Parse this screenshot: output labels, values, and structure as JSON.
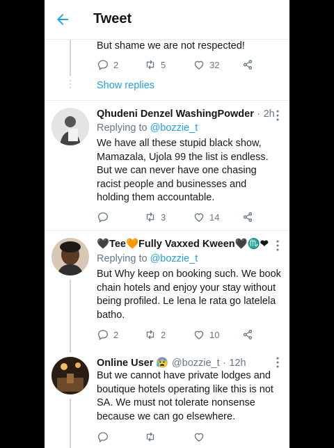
{
  "header": {
    "title": "Tweet"
  },
  "top_tweet": {
    "text": "But shame we are not respected!",
    "replies": "2",
    "retweets": "5",
    "likes": "32",
    "show_replies": "Show replies"
  },
  "tweets": [
    {
      "name": "Qhudeni Denzel WashingPowder",
      "sep": "·",
      "time": "2h",
      "replying_prefix": "Replying to ",
      "replying_to": "@bozzie_t",
      "text": "We have all these stupid black show, Mamazala, Ujola 99 the list is endless. But we can never have one chasing racist people and businesses and holding them accountable.",
      "replies": "",
      "retweets": "3",
      "likes": "14"
    },
    {
      "name": "🖤Tee🧡Fully Vaxxed Kween🖤♏❤",
      "replying_prefix": "Replying to ",
      "replying_to": "@bozzie_t",
      "text": "But Why keep on booking such. We book chain hotels and enjoy your stay without being profiled. Le lena le rata go latelela batho.",
      "replies": "2",
      "retweets": "2",
      "likes": "10"
    },
    {
      "name": "Online User 😰",
      "handle": "@bozzie_t",
      "sep": "·",
      "time": "12h",
      "text": "But we cannot have private lodges and boutique hotels operating like this is not SA. We must not tolerate nonsense because we can go elsewhere.",
      "replies": "",
      "retweets": "",
      "likes": ""
    }
  ],
  "colors": {
    "accent": "#1da1f2",
    "text": "#14171a",
    "muted": "#657786",
    "border": "#e6ecf0"
  }
}
